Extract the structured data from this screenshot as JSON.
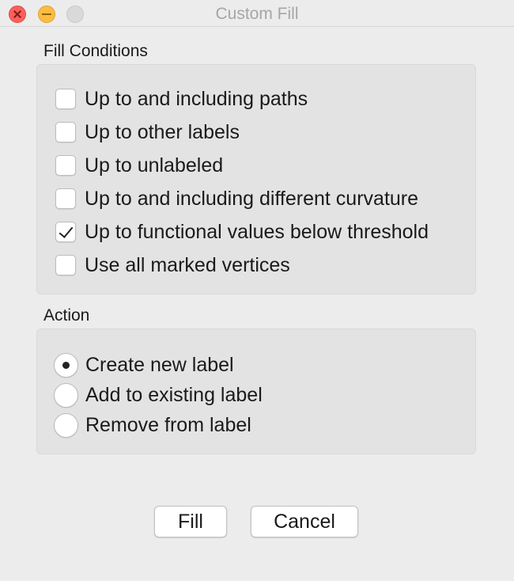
{
  "window": {
    "title": "Custom Fill"
  },
  "fill_conditions": {
    "label": "Fill Conditions",
    "options": [
      {
        "label": "Up to and including paths",
        "checked": false
      },
      {
        "label": "Up to other labels",
        "checked": false
      },
      {
        "label": "Up to unlabeled",
        "checked": false
      },
      {
        "label": "Up to and including different curvature",
        "checked": false
      },
      {
        "label": "Up to functional values below threshold",
        "checked": true
      },
      {
        "label": "Use all marked vertices",
        "checked": false
      }
    ]
  },
  "action": {
    "label": "Action",
    "options": [
      {
        "label": "Create new label",
        "selected": true
      },
      {
        "label": "Add to existing label",
        "selected": false
      },
      {
        "label": "Remove from label",
        "selected": false
      }
    ]
  },
  "buttons": {
    "fill_label": "Fill",
    "cancel_label": "Cancel"
  }
}
